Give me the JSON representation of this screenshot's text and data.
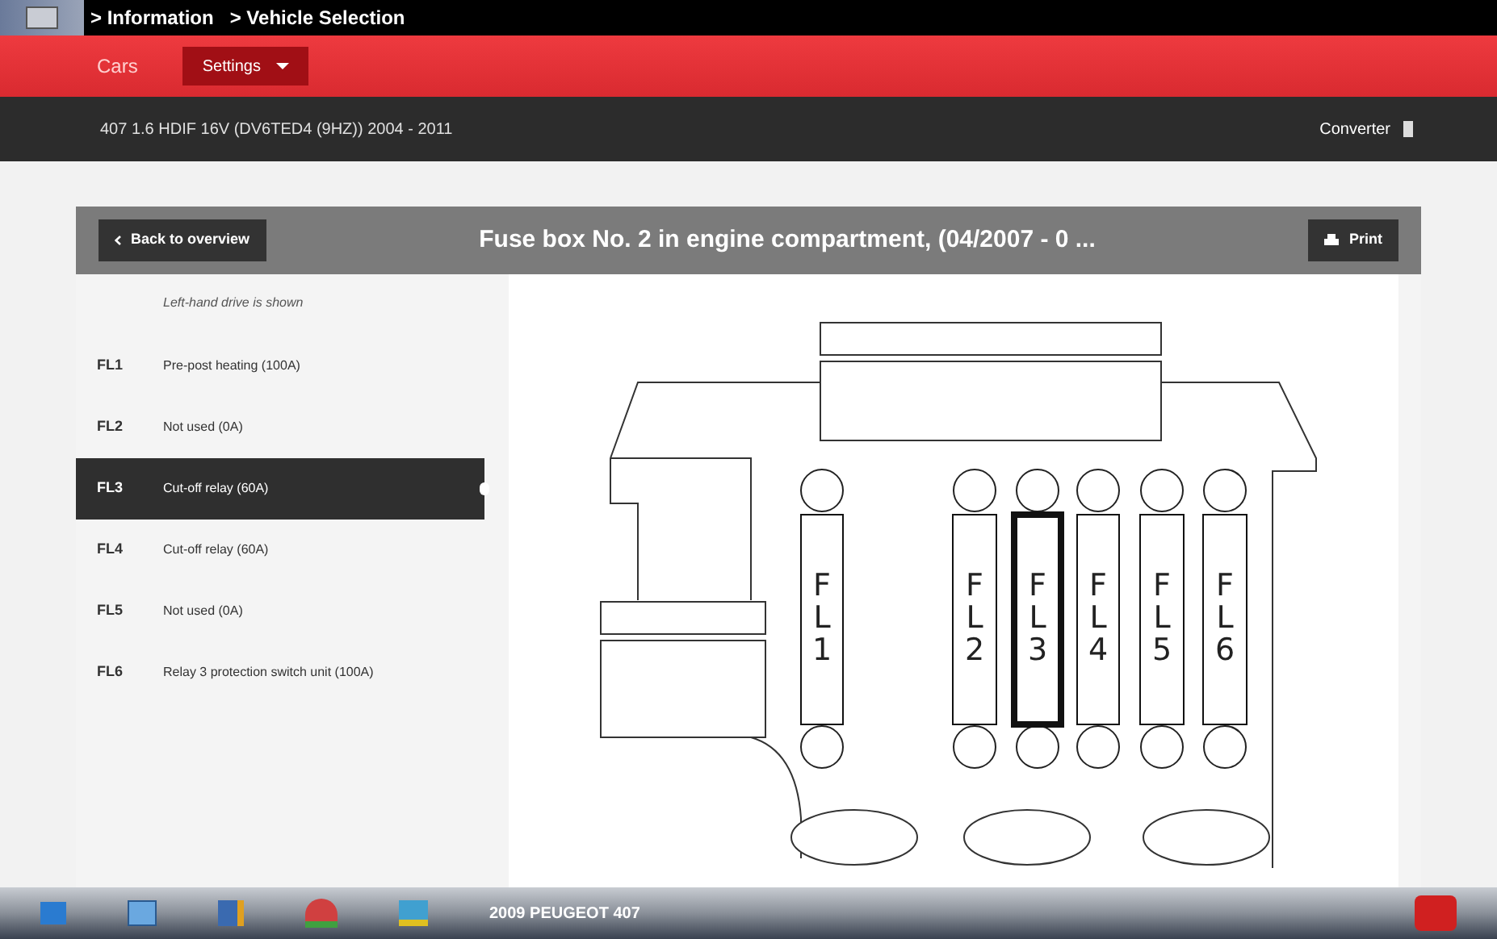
{
  "breadcrumbs": [
    "> Information",
    "> Vehicle Selection"
  ],
  "menu": [
    {
      "label": "Cars",
      "kind": "link"
    },
    {
      "label": "Settings",
      "kind": "dropdown"
    }
  ],
  "vehicle": "407 1.6 HDIF 16V (DV6TED4 (9HZ)) 2004 - 2011",
  "converter": "Converter",
  "header": {
    "back": "Back to overview",
    "title": "Fuse box No. 2 in engine compartment, (04/2007 - 0 ...",
    "print": "Print"
  },
  "note": "Left-hand drive is shown",
  "fuses": [
    {
      "code": "FL1",
      "description": "Pre-post heating (100A)",
      "diagram_label": "FL1",
      "selected": false
    },
    {
      "code": "FL2",
      "description": "Not used (0A)",
      "diagram_label": "FL2",
      "selected": false
    },
    {
      "code": "FL3",
      "description": "Cut-off relay (60A)",
      "diagram_label": "FL3",
      "selected": true
    },
    {
      "code": "FL4",
      "description": "Cut-off relay (60A)",
      "diagram_label": "FL4",
      "selected": false
    },
    {
      "code": "FL5",
      "description": "Not used (0A)",
      "diagram_label": "FL5",
      "selected": false
    },
    {
      "code": "FL6",
      "description": "Relay 3 protection switch unit (100A)",
      "diagram_label": "FL6",
      "selected": false
    }
  ],
  "taskbar": {
    "title": "2009 PEUGEOT 407"
  }
}
